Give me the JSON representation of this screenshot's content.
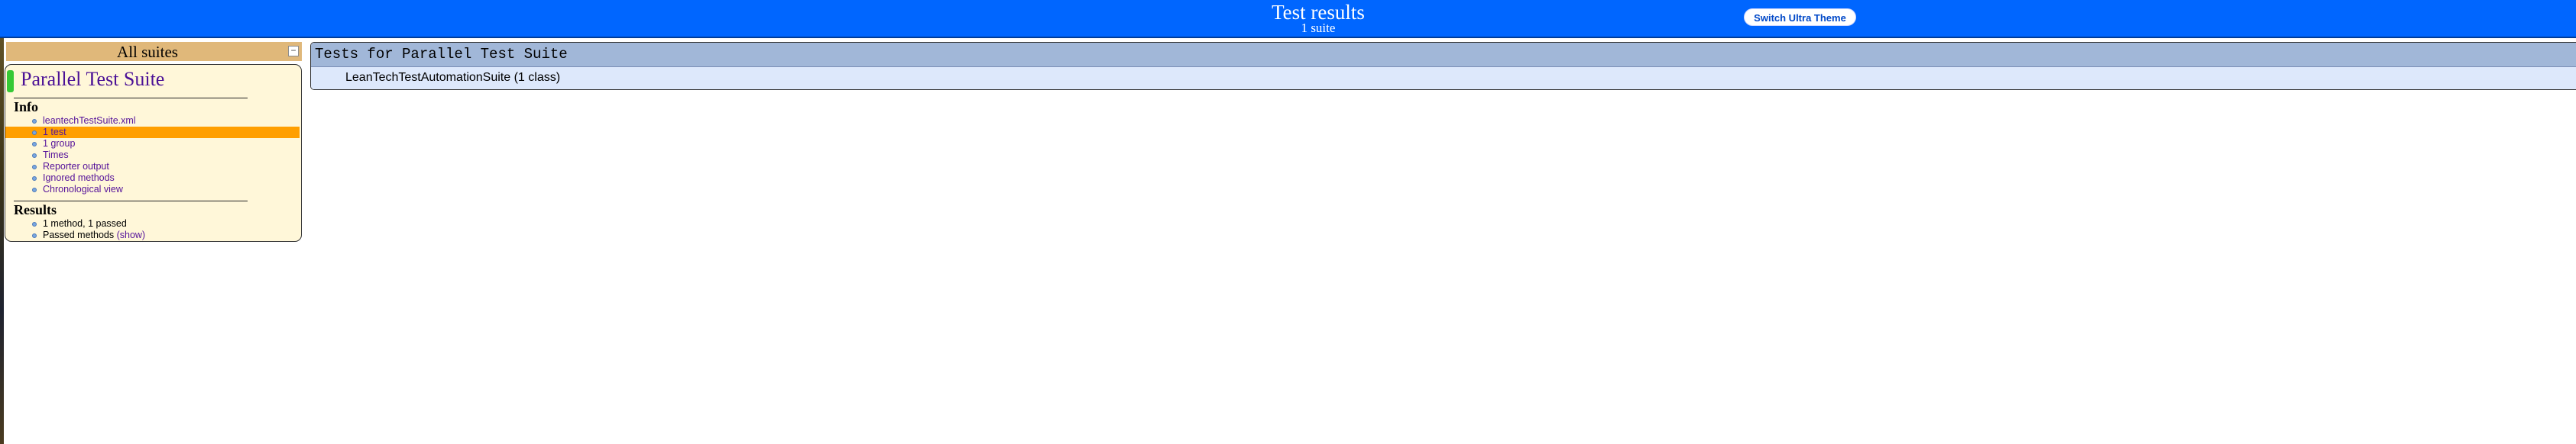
{
  "banner": {
    "title": "Test results",
    "subtitle": "1 suite",
    "switch_theme_label": "Switch Ultra Theme"
  },
  "navigator": {
    "header_title": "All suites",
    "collapse_symbol": "−",
    "suite": {
      "name": "Parallel Test Suite",
      "info_heading": "Info",
      "info_items": [
        "leantechTestSuite.xml",
        "1 test",
        "1 group",
        "Times",
        "Reporter output",
        "Ignored methods",
        "Chronological view"
      ],
      "active_info_item": "1 test",
      "results_heading": "Results",
      "result_summary": "1 method, 1 passed",
      "passed_methods_label": "Passed methods",
      "show_link": "(show)"
    }
  },
  "main": {
    "header": "Tests for Parallel Test Suite",
    "row": "LeanTechTestAutomationSuite (1 class)"
  },
  "colors": {
    "banner": "#0066ff",
    "nav_header": "#e0b87a",
    "suite_panel": "#fff7d9",
    "active_item": "#ff9f00",
    "suite_marker": "#36c936",
    "main_header": "#a1b7d8",
    "main_row": "#dde8fb"
  }
}
